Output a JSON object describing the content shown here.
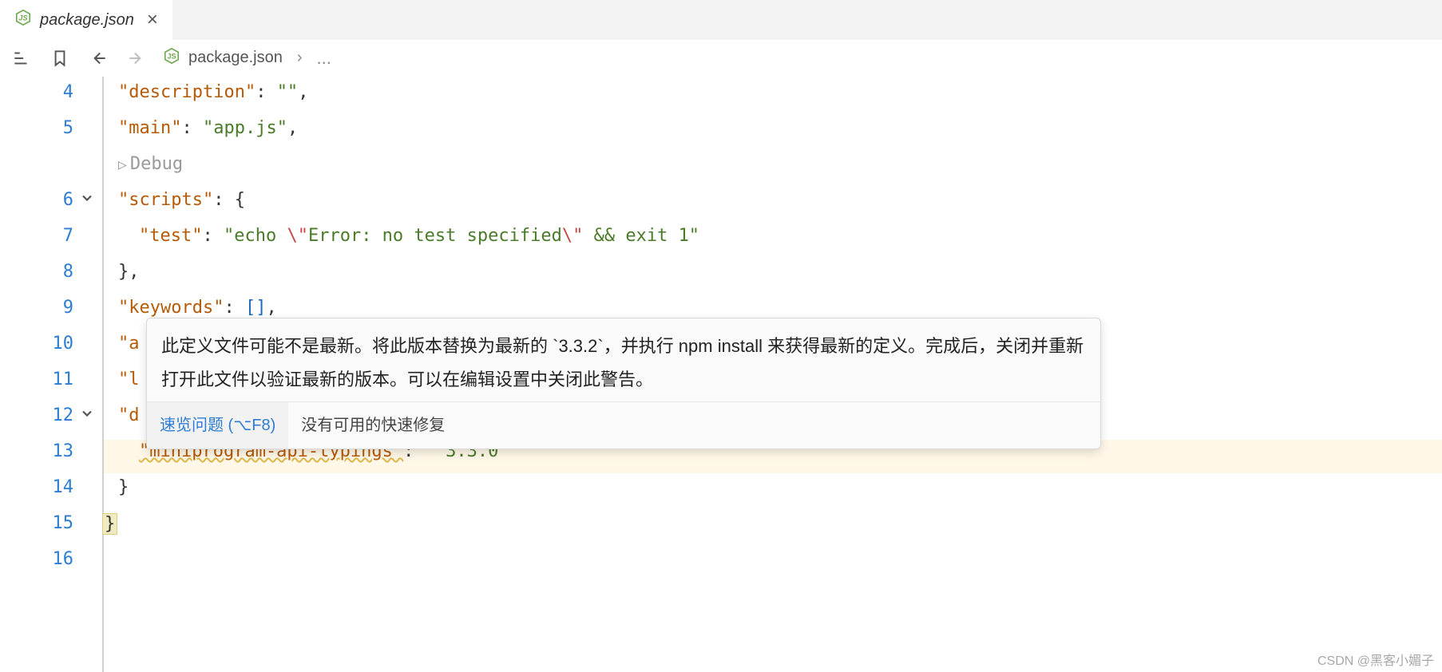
{
  "tab": {
    "filename": "package.json",
    "close": "×"
  },
  "breadcrumb": {
    "filename": "package.json",
    "ellipsis": "..."
  },
  "gutter": {
    "4": "4",
    "5": "5",
    "6": "6",
    "7": "7",
    "8": "8",
    "9": "9",
    "10": "10",
    "11": "11",
    "12": "12",
    "13": "13",
    "14": "14",
    "15": "15",
    "16": "16"
  },
  "code": {
    "l4a": "\"description\"",
    "l4b": ": ",
    "l4c": "\"\"",
    "l4d": ",",
    "l5a": "\"main\"",
    "l5b": ": ",
    "l5c": "\"app.js\"",
    "l5d": ",",
    "debugPrefix": "▷",
    "debug": "Debug",
    "l6a": "\"scripts\"",
    "l6b": ": {",
    "l7a": "\"test\"",
    "l7b": ": ",
    "l7c1": "\"echo ",
    "l7c2": "\\\"",
    "l7c3": "Error: no test specified",
    "l7c4": "\\\"",
    "l7c5": " && exit 1\"",
    "l8": "},",
    "l9a": "\"keywords\"",
    "l9b": ": ",
    "l9c": "[]",
    "l9d": ",",
    "l10a": "\"a",
    "l11a": "\"l",
    "l12a": "\"d",
    "l13a": "\"miniprogram-api-typings\"",
    "l13b": ": ",
    "l13c": "\"^3.3.0\"",
    "l14": "}",
    "l15": "}"
  },
  "hover": {
    "message": "此定义文件可能不是最新。将此版本替换为最新的 `3.3.2`，并执行 npm install 来获得最新的定义。完成后，关闭并重新打开此文件以验证最新的版本。可以在编辑设置中关闭此警告。",
    "peek": "速览问题 (⌥F8)",
    "nofix": "没有可用的快速修复"
  },
  "watermark": "CSDN @黑客小媚子"
}
